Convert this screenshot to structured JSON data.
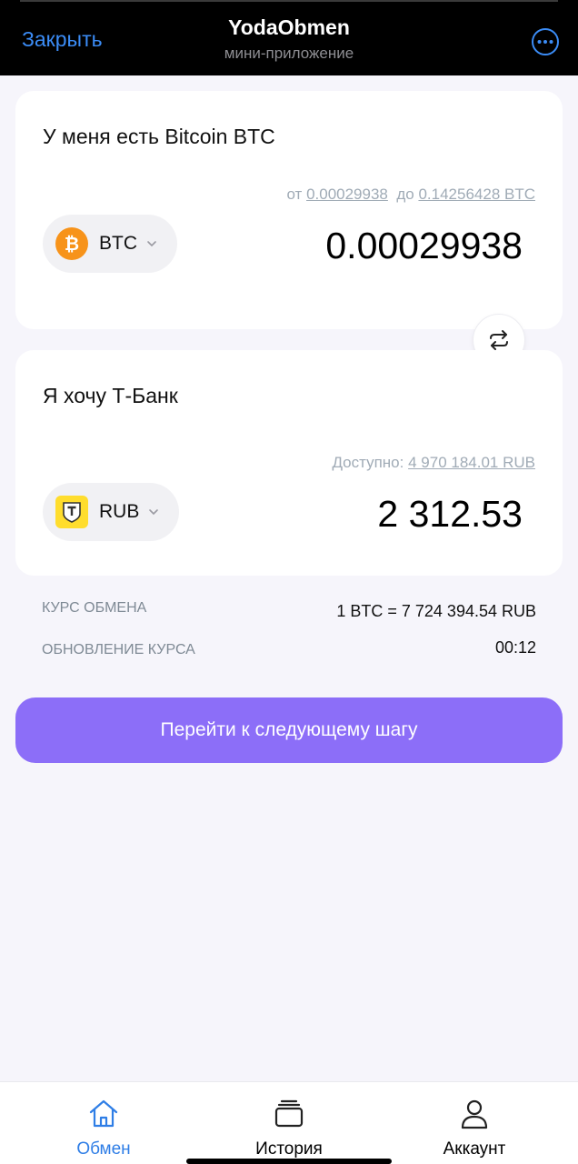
{
  "header": {
    "close_label": "Закрыть",
    "title": "YodaObmen",
    "subtitle": "мини-приложение"
  },
  "from_card": {
    "title": "У меня есть Bitcoin BTC",
    "range_from_prefix": "от",
    "range_min": "0.00029938",
    "range_to_prefix": "до",
    "range_max": "0.14256428 BTC",
    "currency": "BTC",
    "amount": "0.00029938"
  },
  "to_card": {
    "title": "Я хочу Т-Банк",
    "available_label": "Доступно:",
    "available_value": "4 970 184.01 RUB",
    "currency": "RUB",
    "amount": "2 312.53"
  },
  "info": {
    "rate_label": "КУРС ОБМЕНА",
    "rate_value": "1 BTC = 7 724 394.54 RUB",
    "update_label": "ОБНОВЛЕНИЕ КУРСА",
    "update_value": "00:12"
  },
  "next_button": "Перейти к следующему шагу",
  "nav": {
    "exchange": "Обмен",
    "history": "История",
    "account": "Аккаунт"
  },
  "colors": {
    "accent": "#8c6ef8",
    "link": "#3b8cf6",
    "bitcoin": "#f7931a",
    "tbank": "#ffdd2d"
  }
}
